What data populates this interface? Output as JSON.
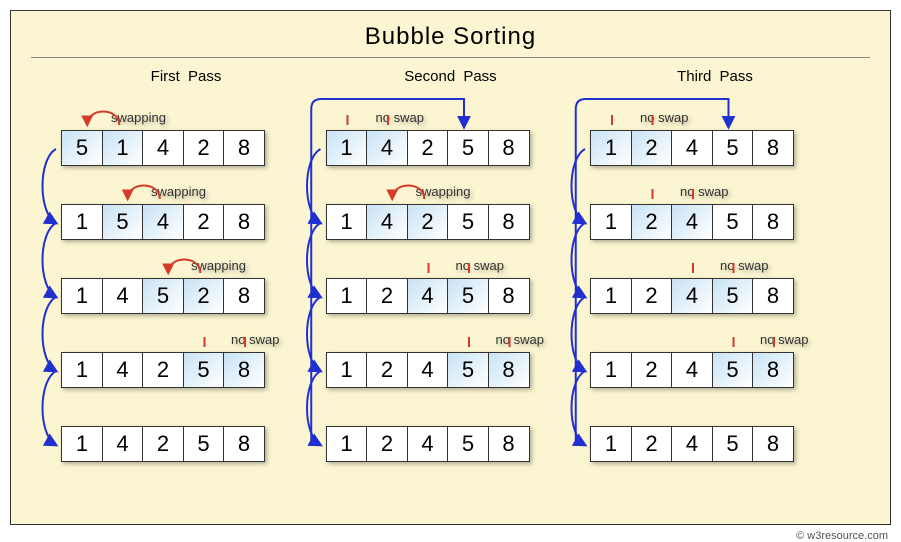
{
  "title": "Bubble  Sorting",
  "credit": "© w3resource.com",
  "labels": {
    "swap": "swapping",
    "noswap": "no swap"
  },
  "passes": [
    {
      "name": "First  Pass",
      "rows": [
        {
          "cells": [
            5,
            1,
            4,
            2,
            8
          ],
          "hl": [
            0,
            1
          ],
          "action": "swap"
        },
        {
          "cells": [
            1,
            5,
            4,
            2,
            8
          ],
          "hl": [
            1,
            2
          ],
          "action": "swap"
        },
        {
          "cells": [
            1,
            4,
            5,
            2,
            8
          ],
          "hl": [
            2,
            3
          ],
          "action": "swap"
        },
        {
          "cells": [
            1,
            4,
            2,
            5,
            8
          ],
          "hl": [
            3,
            4
          ],
          "action": "noswap"
        },
        {
          "cells": [
            1,
            4,
            2,
            5,
            8
          ],
          "hl": [],
          "action": null
        }
      ]
    },
    {
      "name": "Second  Pass",
      "rows": [
        {
          "cells": [
            1,
            4,
            2,
            5,
            8
          ],
          "hl": [
            0,
            1
          ],
          "action": "noswap"
        },
        {
          "cells": [
            1,
            4,
            2,
            5,
            8
          ],
          "hl": [
            1,
            2
          ],
          "action": "swap"
        },
        {
          "cells": [
            1,
            2,
            4,
            5,
            8
          ],
          "hl": [
            2,
            3
          ],
          "action": "noswap"
        },
        {
          "cells": [
            1,
            2,
            4,
            5,
            8
          ],
          "hl": [
            3,
            4
          ],
          "action": "noswap"
        },
        {
          "cells": [
            1,
            2,
            4,
            5,
            8
          ],
          "hl": [],
          "action": null
        }
      ]
    },
    {
      "name": "Third  Pass",
      "rows": [
        {
          "cells": [
            1,
            2,
            4,
            5,
            8
          ],
          "hl": [
            0,
            1
          ],
          "action": "noswap"
        },
        {
          "cells": [
            1,
            2,
            4,
            5,
            8
          ],
          "hl": [
            1,
            2
          ],
          "action": "noswap"
        },
        {
          "cells": [
            1,
            2,
            4,
            5,
            8
          ],
          "hl": [
            2,
            3
          ],
          "action": "noswap"
        },
        {
          "cells": [
            1,
            2,
            4,
            5,
            8
          ],
          "hl": [
            3,
            4
          ],
          "action": "noswap"
        },
        {
          "cells": [
            1,
            2,
            4,
            5,
            8
          ],
          "hl": [],
          "action": null
        }
      ]
    }
  ]
}
